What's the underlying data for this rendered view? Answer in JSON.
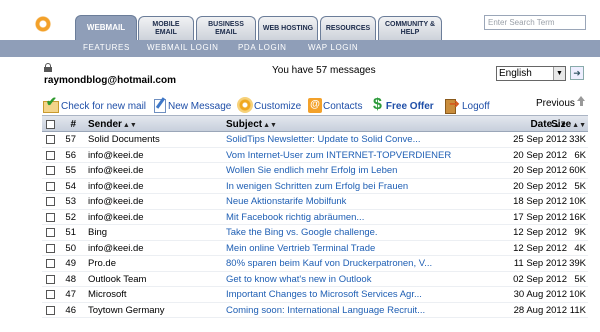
{
  "nav": {
    "tabs": [
      {
        "label": "WEBMAIL"
      },
      {
        "label": "MOBILE EMAIL"
      },
      {
        "label": "BUSINESS EMAIL"
      },
      {
        "label": "WEB HOSTING"
      },
      {
        "label": "RESOURCES"
      },
      {
        "label": "COMMUNITY & HELP"
      }
    ],
    "search_placeholder": "Enter Search Term",
    "sub_links": [
      "FEATURES",
      "WEBMAIL LOGIN",
      "PDA LOGIN",
      "WAP LOGIN"
    ]
  },
  "account": {
    "email": "raymondblog@hotmail.com",
    "message_count": "You have 57 messages",
    "language": "English"
  },
  "toolbar": {
    "check": "Check for new mail",
    "new_message": "New Message",
    "customize": "Customize",
    "contacts": "Contacts",
    "free_offer": "Free Offer",
    "logoff": "Logoff",
    "previous": "Previous"
  },
  "table": {
    "headers": {
      "num": "#",
      "sender": "Sender",
      "subject": "Subject",
      "date": "Date",
      "size": "Size"
    },
    "rows": [
      {
        "num": "57",
        "sender": "Solid Documents",
        "subject": "SolidTips Newsletter: Update to Solid Conve...",
        "date": "25 Sep 2012",
        "size": "33K"
      },
      {
        "num": "56",
        "sender": "info@keei.de",
        "subject": "Vom Internet-User zum INTERNET-TOPVERDIENER",
        "date": "20 Sep 2012",
        "size": "6K"
      },
      {
        "num": "55",
        "sender": "info@keei.de",
        "subject": "Wollen Sie endlich mehr Erfolg im Leben",
        "date": "20 Sep 2012",
        "size": "60K"
      },
      {
        "num": "54",
        "sender": "info@keei.de",
        "subject": "In wenigen Schritten zum Erfolg bei Frauen",
        "date": "20 Sep 2012",
        "size": "5K"
      },
      {
        "num": "53",
        "sender": "info@keei.de",
        "subject": "Neue Aktionstarife Mobilfunk",
        "date": "18 Sep 2012",
        "size": "10K"
      },
      {
        "num": "52",
        "sender": "info@keei.de",
        "subject": "Mit Facebook richtig abräumen...",
        "date": "17 Sep 2012",
        "size": "16K"
      },
      {
        "num": "51",
        "sender": "Bing",
        "subject": "Take the Bing vs. Google challenge.",
        "date": "12 Sep 2012",
        "size": "9K"
      },
      {
        "num": "50",
        "sender": "info@keei.de",
        "subject": "Mein online Vertrieb Terminal Trade",
        "date": "12 Sep 2012",
        "size": "4K"
      },
      {
        "num": "49",
        "sender": "Pro.de",
        "subject": "80% sparen beim Kauf von Druckerpatronen, V...",
        "date": "11 Sep 2012",
        "size": "39K"
      },
      {
        "num": "48",
        "sender": "Outlook Team",
        "subject": "Get to know what's new in Outlook",
        "date": "02 Sep 2012",
        "size": "5K"
      },
      {
        "num": "47",
        "sender": "Microsoft",
        "subject": "Important Changes to Microsoft Services Agr...",
        "date": "30 Aug 2012",
        "size": "10K"
      },
      {
        "num": "46",
        "sender": "Toytown Germany",
        "subject": "Coming soon: International Language Recruit...",
        "date": "28 Aug 2012",
        "size": "11K"
      }
    ]
  }
}
